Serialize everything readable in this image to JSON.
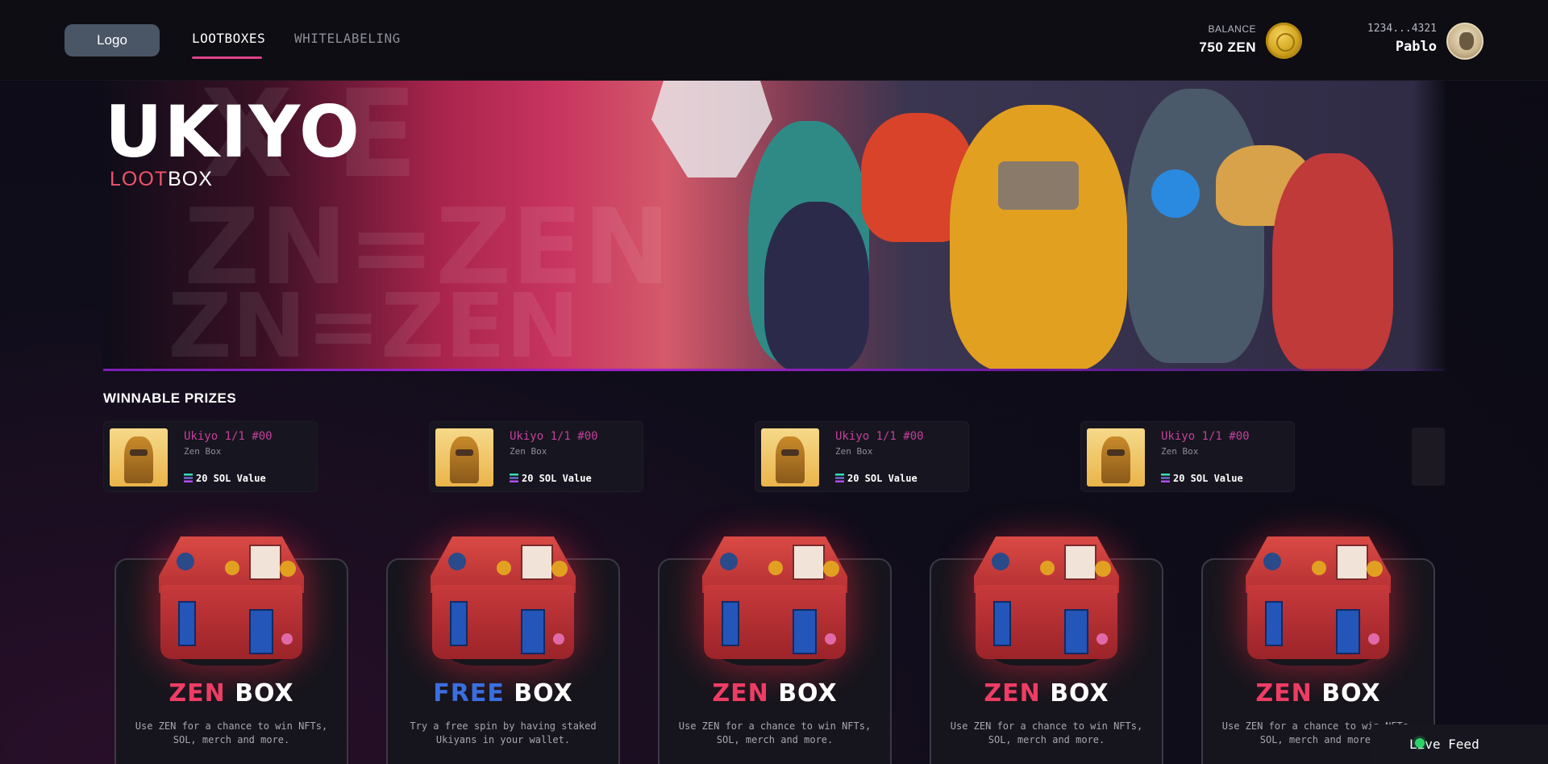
{
  "header": {
    "logo_label": "Logo",
    "nav": [
      {
        "label": "LOOTBOXES",
        "active": true
      },
      {
        "label": "WHITELABELING",
        "active": false
      }
    ],
    "balance_label": "BALANCE",
    "balance_value": "750 ZEN",
    "coin_icon": "zen-coin-icon",
    "wallet_address": "1234...4321",
    "user_name": "Pablo",
    "accent_color": "#e0408a"
  },
  "banner": {
    "title": "UKIYO",
    "subtitle_accent": "LOOT",
    "subtitle_rest": "BOX",
    "subtitle_accent_color": "#f2526a"
  },
  "prizes": {
    "section_title": "WINNABLE PRIZES",
    "items": [
      {
        "name": "Ukiyo 1/1 #00",
        "box": "Zen Box",
        "value": "20 SOL Value"
      },
      {
        "name": "Ukiyo 1/1 #00",
        "box": "Zen Box",
        "value": "20 SOL Value"
      },
      {
        "name": "Ukiyo 1/1 #00",
        "box": "Zen Box",
        "value": "20 SOL Value"
      },
      {
        "name": "Ukiyo 1/1 #00",
        "box": "Zen Box",
        "value": "20 SOL Value"
      }
    ]
  },
  "boxes": [
    {
      "title_accent": "ZEN",
      "title_rest": "BOX",
      "accent": "red",
      "description": "Use ZEN for a chance to win NFTs, SOL, merch and more."
    },
    {
      "title_accent": "FREE",
      "title_rest": "BOX",
      "accent": "blue",
      "description": "Try a free spin by having staked Ukiyans in your wallet."
    },
    {
      "title_accent": "ZEN",
      "title_rest": "BOX",
      "accent": "red",
      "description": "Use ZEN for a chance to win NFTs, SOL, merch and more."
    },
    {
      "title_accent": "ZEN",
      "title_rest": "BOX",
      "accent": "red",
      "description": "Use ZEN for a chance to win NFTs, SOL, merch and more."
    },
    {
      "title_accent": "ZEN",
      "title_rest": "BOX",
      "accent": "red",
      "description": "Use ZEN for a chance to win NFTs, SOL, merch and more."
    }
  ],
  "live_feed": {
    "label": "Live Feed",
    "status_color": "#2bd46a"
  }
}
